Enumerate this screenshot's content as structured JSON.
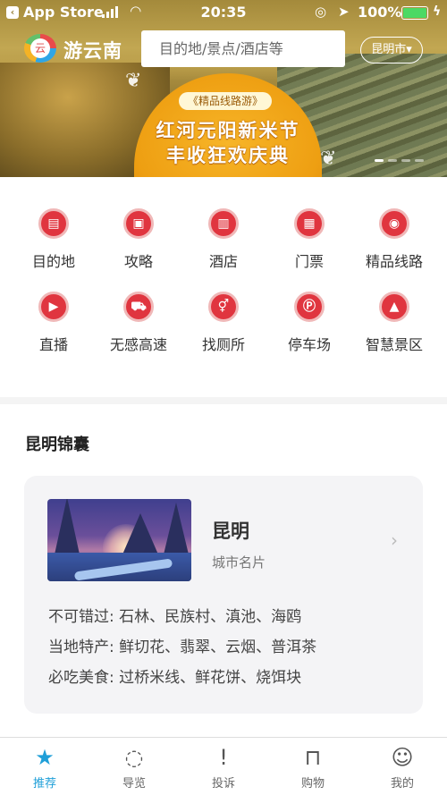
{
  "status_bar": {
    "back_label": "App Store",
    "time": "20:35",
    "battery": "100%",
    "battery_level": 1.0,
    "signal_bars": 4
  },
  "header": {
    "logo_text": "游云南",
    "search_placeholder": "目的地/景点/酒店等",
    "city": "昆明市▾"
  },
  "banner": {
    "tag": "《精品线路游》",
    "line1": "红河元阳新米节",
    "line2": "丰收狂欢庆典",
    "slides": 4,
    "active_slide": 1
  },
  "categories": [
    {
      "label": "目的地",
      "icon": "destination-icon",
      "glyph": "▤"
    },
    {
      "label": "攻略",
      "icon": "guide-icon",
      "glyph": "▣"
    },
    {
      "label": "酒店",
      "icon": "hotel-icon",
      "glyph": "▥"
    },
    {
      "label": "门票",
      "icon": "ticket-icon",
      "glyph": "▦"
    },
    {
      "label": "精品线路",
      "icon": "route-icon",
      "glyph": "◉"
    },
    {
      "label": "直播",
      "icon": "live-icon",
      "glyph": "▶"
    },
    {
      "label": "无感高速",
      "icon": "car-icon",
      "glyph": "⛟"
    },
    {
      "label": "找厕所",
      "icon": "toilet-icon",
      "glyph": "⚥"
    },
    {
      "label": "停车场",
      "icon": "parking-icon",
      "glyph": "Ⓟ"
    },
    {
      "label": "智慧景区",
      "icon": "mountain-icon",
      "glyph": "▲"
    }
  ],
  "section": {
    "title": "昆明锦囊",
    "card": {
      "name": "昆明",
      "subtitle": "城市名片",
      "row1": "不可错过: 石林、民族村、滇池、海鸥",
      "row2": "当地特产: 鲜切花、翡翠、云烟、普洱茶",
      "row3": "必吃美食: 过桥米线、鲜花饼、烧饵块"
    }
  },
  "tabbar": [
    {
      "label": "推荐",
      "icon": "star-icon",
      "glyph": "★",
      "active": true
    },
    {
      "label": "导览",
      "icon": "audio-guide-icon",
      "glyph": "◌",
      "active": false
    },
    {
      "label": "投诉",
      "icon": "complaint-icon",
      "glyph": "!",
      "active": false
    },
    {
      "label": "购物",
      "icon": "shopping-bag-icon",
      "glyph": "⊓",
      "active": false
    },
    {
      "label": "我的",
      "icon": "profile-icon",
      "glyph": "☺",
      "active": false
    }
  ],
  "colors": {
    "accent": "#1f9fd8",
    "category_icon": "#e0353f",
    "banner_badge": "#ee9f12"
  }
}
